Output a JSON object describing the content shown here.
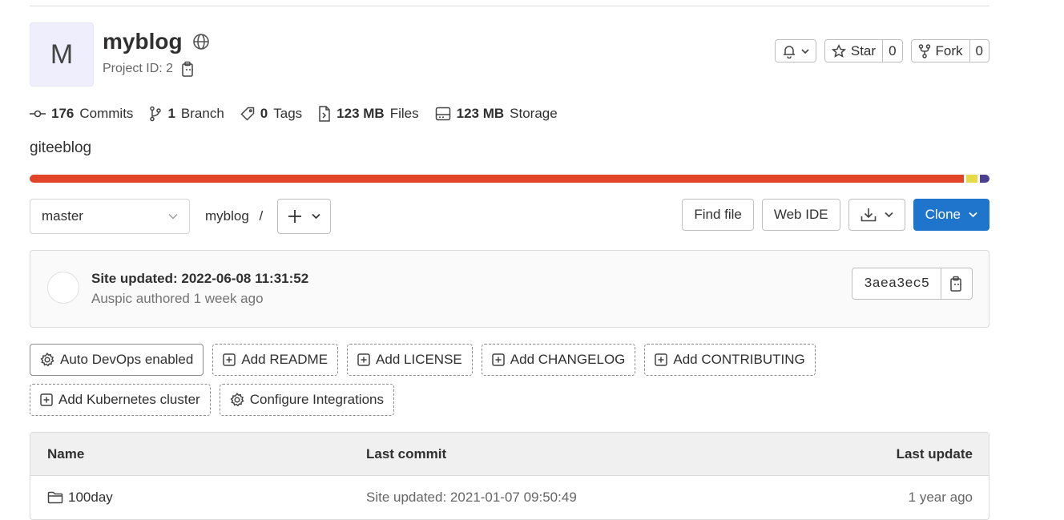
{
  "project": {
    "avatar_letter": "M",
    "name": "myblog",
    "visibility_icon": "globe-icon",
    "id_label": "Project ID: 2"
  },
  "header_actions": {
    "notification_icon": "bell-icon",
    "star_label": "Star",
    "star_count": "0",
    "fork_label": "Fork",
    "fork_count": "0"
  },
  "stats": [
    {
      "icon": "commit-icon",
      "value": "176",
      "label": "Commits"
    },
    {
      "icon": "branch-icon",
      "value": "1",
      "label": "Branch"
    },
    {
      "icon": "tag-icon",
      "value": "0",
      "label": "Tags"
    },
    {
      "icon": "file-icon",
      "value": "123 MB",
      "label": "Files"
    },
    {
      "icon": "storage-icon",
      "value": "123 MB",
      "label": "Storage"
    }
  ],
  "description": "giteeblog",
  "language_bar": {
    "segments": [
      {
        "color": "#e24329"
      },
      {
        "color": "#e6d94a"
      },
      {
        "color": "#4c3f91"
      }
    ]
  },
  "toolbar": {
    "branch": "master",
    "breadcrumb_project": "myblog",
    "breadcrumb_sep": "/",
    "find_file": "Find file",
    "web_ide": "Web IDE",
    "clone": "Clone"
  },
  "last_commit": {
    "title": "Site updated: 2022-06-08 11:31:52",
    "meta": "Auspic authored 1 week ago",
    "sha": "3aea3ec5"
  },
  "quick_actions": {
    "row1": [
      "Auto DevOps enabled",
      "Add README",
      "Add LICENSE",
      "Add CHANGELOG",
      "Add CONTRIBUTING"
    ],
    "row2": [
      "Add Kubernetes cluster",
      "Configure Integrations"
    ]
  },
  "file_table": {
    "headers": {
      "name": "Name",
      "last_commit": "Last commit",
      "last_update": "Last update"
    },
    "rows": [
      {
        "name": "100day",
        "last_commit": "Site updated: 2021-01-07 09:50:49",
        "last_update": "1 year ago"
      }
    ]
  },
  "colors": {
    "accent": "#1f75cb"
  }
}
